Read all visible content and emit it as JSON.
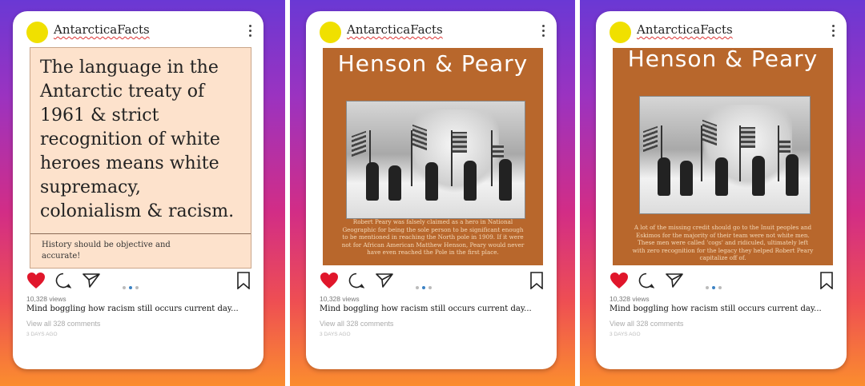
{
  "account": {
    "username": "AntarcticaFacts"
  },
  "posts": [
    {
      "text": "The language in the Antarctic treaty of 1961 & strict recognition of white heroes means white supremacy, colonialism & racism.",
      "subtext": "History should be objective and accurate!",
      "views": "10,328 views",
      "description": "Mind boggling how racism still occurs current day...",
      "comments": "View all 328 comments",
      "ago": "3 DAYS AGO"
    },
    {
      "title": "Henson & Peary",
      "caption": "Robert Peary was falsely claimed as a hero in National Geographic for being the sole person to be significant enough to be mentioned in reaching the North pole in 1909. If it were not for African American Matthew Henson, Peary would never have even reached the Pole in the first place.",
      "views": "10,328 views",
      "description": "Mind boggling how racism still occurs current day...",
      "comments": "View all 328 comments",
      "ago": "3 DAYS AGO"
    },
    {
      "title": "Henson & Peary",
      "caption": "A lot of the missing credit should go to the Inuit peoples and Eskimos for the majority of their team were not white men. These men were called 'cogs' and ridiculed, ultimately left with zero recognition for the legacy they helped Robert Peary capitalize off of.",
      "views": "10,328 views",
      "description": "Mind boggling how racism still occurs current day...",
      "comments": "View all 328 comments",
      "ago": "3 DAYS AGO"
    }
  ],
  "icons": {
    "like": "heart-icon",
    "comment": "comment-icon",
    "share": "send-icon",
    "save": "bookmark-icon",
    "more": "more-icon"
  },
  "colors": {
    "heart": "#e0162b",
    "post_brown": "#b8672c",
    "post_peach": "#fde2cc",
    "avatar": "#f0e000",
    "carousel_active": "#3b82c4"
  }
}
